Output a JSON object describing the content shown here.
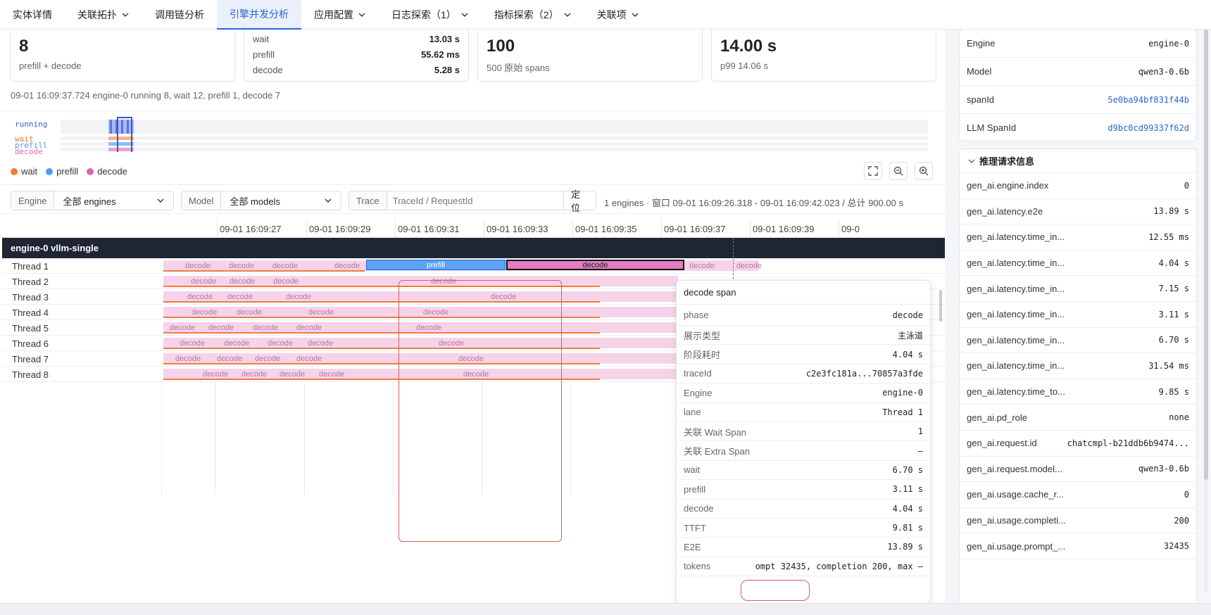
{
  "tabs": [
    {
      "label": "实体详情",
      "dropdown": false,
      "active": false
    },
    {
      "label": "关联拓扑",
      "dropdown": true,
      "active": false
    },
    {
      "label": "调用链分析",
      "dropdown": false,
      "active": false
    },
    {
      "label": "引擎并发分析",
      "dropdown": false,
      "active": true
    },
    {
      "label": "应用配置",
      "dropdown": true,
      "active": false
    },
    {
      "label": "日志探索（1）",
      "dropdown": true,
      "active": false
    },
    {
      "label": "指标探索（2）",
      "dropdown": true,
      "active": false
    },
    {
      "label": "关联项",
      "dropdown": true,
      "active": false
    }
  ],
  "cards": {
    "running": {
      "value": "8",
      "sub": "prefill + decode"
    },
    "phases": [
      {
        "k": "wait",
        "v": "13.03 s"
      },
      {
        "k": "prefill",
        "v": "55.62 ms"
      },
      {
        "k": "decode",
        "v": "5.28 s"
      }
    ],
    "spans": {
      "value": "100",
      "sub": "500 原始 spans"
    },
    "latency": {
      "value": "14.00 s",
      "sub": "p99 14.06 s"
    }
  },
  "status_line": "09-01 16:09:37.724 engine-0 running 8, wait 12, prefill 1, decode 7",
  "minimap": {
    "labels": [
      "running",
      "wait",
      "prefill",
      "decode"
    ],
    "legend": [
      {
        "label": "wait",
        "color": "#f07c3a"
      },
      {
        "label": "prefill",
        "color": "#4a9af5"
      },
      {
        "label": "decode",
        "color": "#d866b4"
      }
    ]
  },
  "filters": {
    "engine_label": "Engine",
    "engine_value": "全部 engines",
    "model_label": "Model",
    "model_value": "全部 models",
    "trace_label": "Trace",
    "trace_placeholder": "TraceId / RequestId",
    "locate_button": "定位",
    "summary": "1 engines · 窗口 09-01 16:09:26.318 - 09-01 16:09:42.023 / 总计 900.00 s"
  },
  "axis_ticks": [
    "09-01 16:09:27",
    "09-01 16:09:29",
    "09-01 16:09:31",
    "09-01 16:09:33",
    "09-01 16:09:35",
    "09-01 16:09:37",
    "09-01 16:09:39",
    "09-0"
  ],
  "engine_header": "engine-0  vllm-single",
  "threads": [
    "Thread 1",
    "Thread 2",
    "Thread 3",
    "Thread 4",
    "Thread 5",
    "Thread 6",
    "Thread 7",
    "Thread 8"
  ],
  "span_labels": {
    "decode": "decode",
    "prefill": "prefill"
  },
  "tooltip": {
    "title": "decode span",
    "rows": [
      {
        "k": "phase",
        "v": "decode"
      },
      {
        "k": "展示类型",
        "v": "主泳道"
      },
      {
        "k": "阶段耗时",
        "v": "4.04 s"
      },
      {
        "k": "traceId",
        "v": "c2e3fc181a...70857a3fde"
      },
      {
        "k": "Engine",
        "v": "engine-0"
      },
      {
        "k": "lane",
        "v": "Thread 1"
      },
      {
        "k": "关联 Wait Span",
        "v": "1"
      },
      {
        "k": "关联 Extra Span",
        "v": "–"
      },
      {
        "k": "wait",
        "v": "6.70 s"
      },
      {
        "k": "prefill",
        "v": "3.11 s"
      },
      {
        "k": "decode",
        "v": "4.04 s"
      },
      {
        "k": "TTFT",
        "v": "9.81 s"
      },
      {
        "k": "E2E",
        "v": "13.89 s"
      },
      {
        "k": "tokens",
        "v": "ompt 32435, completion 200, max –"
      }
    ]
  },
  "right_panel": {
    "top_rows": [
      {
        "k": "Engine",
        "v": "engine-0",
        "link": false
      },
      {
        "k": "Model",
        "v": "qwen3-0.6b",
        "link": false
      },
      {
        "k": "spanId",
        "v": "5e0ba94bf831f44b",
        "link": true
      },
      {
        "k": "LLM SpanId",
        "v": "d9bc0cd99337f62d",
        "link": true
      }
    ],
    "section_title": "推理请求信息",
    "rows": [
      {
        "k": "gen_ai.engine.index",
        "v": "0"
      },
      {
        "k": "gen_ai.latency.e2e",
        "v": "13.89 s"
      },
      {
        "k": "gen_ai.latency.time_in...",
        "v": "12.55 ms"
      },
      {
        "k": "gen_ai.latency.time_in...",
        "v": "4.04 s"
      },
      {
        "k": "gen_ai.latency.time_in...",
        "v": "7.15 s"
      },
      {
        "k": "gen_ai.latency.time_in...",
        "v": "3.11 s"
      },
      {
        "k": "gen_ai.latency.time_in...",
        "v": "6.70 s"
      },
      {
        "k": "gen_ai.latency.time_in...",
        "v": "31.54 ms"
      },
      {
        "k": "gen_ai.latency.time_to...",
        "v": "9.85 s"
      },
      {
        "k": "gen_ai.pd_role",
        "v": "none"
      },
      {
        "k": "gen_ai.request.id",
        "v": "chatcmpl-b21ddb6b9474..."
      },
      {
        "k": "gen_ai.request.model...",
        "v": "qwen3-0.6b"
      },
      {
        "k": "gen_ai.usage.cache_r...",
        "v": "0"
      },
      {
        "k": "gen_ai.usage.completi...",
        "v": "200"
      },
      {
        "k": "gen_ai.usage.prompt_...",
        "v": "32435"
      }
    ]
  }
}
